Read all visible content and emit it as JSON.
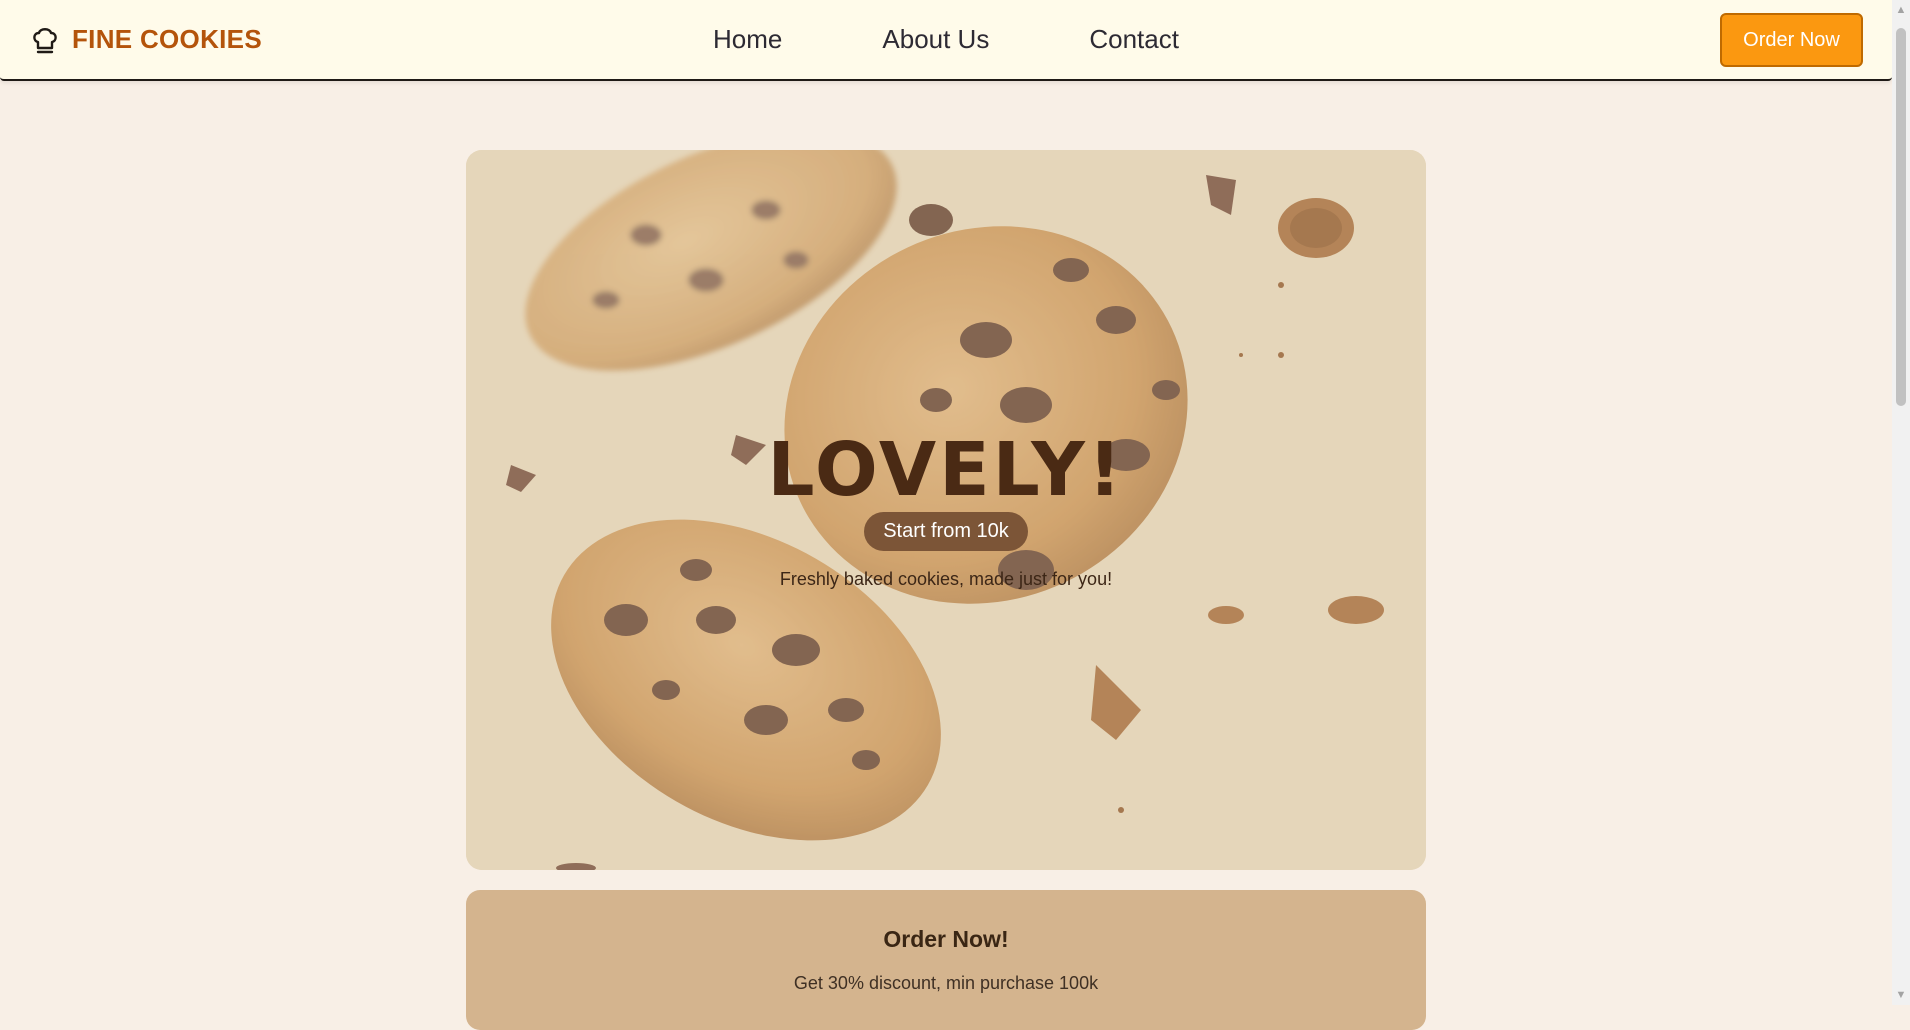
{
  "navbar": {
    "brand_name": "FINE COOKIES",
    "brand_icon": "chef-hat-icon",
    "links": [
      "Home",
      "About Us",
      "Contact"
    ],
    "cta_label": "Order Now"
  },
  "hero": {
    "title": "LOVELY!",
    "price_badge": "Start from 10k",
    "subtitle": "Freshly baked cookies, made just for you!",
    "image": "chocolate-chip-cookies-image"
  },
  "order_section": {
    "title": "Order Now!",
    "text": "Get 30% discount, min purchase 100k"
  },
  "colors": {
    "page_bg": "#f8efe6",
    "navbar_bg": "#fffbea",
    "brand": "#b4540b",
    "cta": "#fb9810",
    "hero_bg": "#e6d6bb",
    "title": "#4a2a14",
    "badge": "#7c5537",
    "order_bg": "#d4b48e"
  }
}
